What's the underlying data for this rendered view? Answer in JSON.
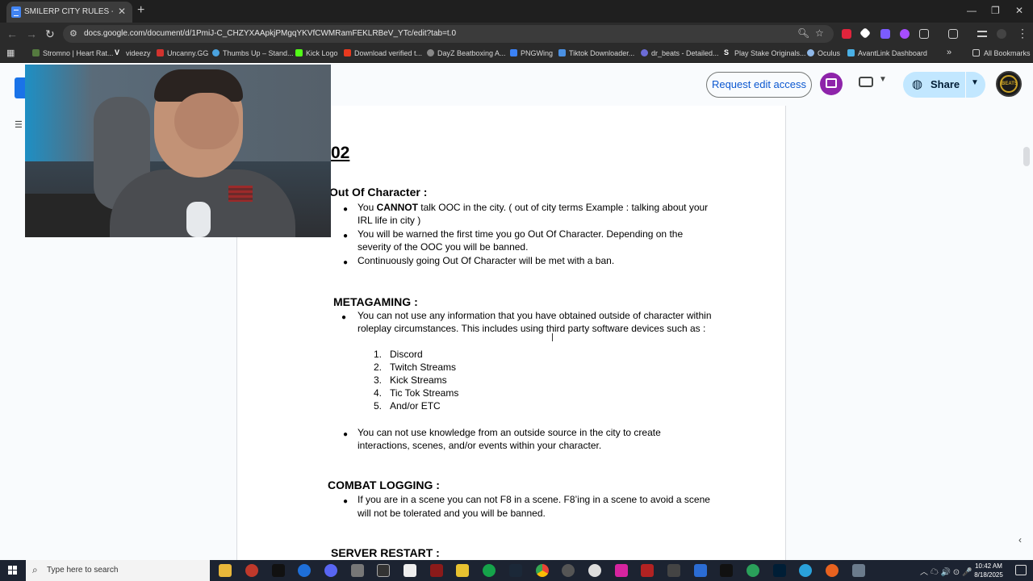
{
  "browser": {
    "tab_title": "SMILERP CITY RULES - Google",
    "new_tab": "+",
    "tab_close": "✕",
    "url": "docs.google.com/document/d/1PmiJ-C_CHZYXAApkjPMgqYKVfCWMRamFEKLRBeV_YTc/edit?tab=t.0",
    "window_controls": {
      "minimize": "—",
      "restore": "❐",
      "close": "✕"
    },
    "nav": {
      "back": "←",
      "forward": "→",
      "reload": "↻"
    },
    "bookmarks": [
      "Stromno | Heart Rat...",
      "videezy",
      "Uncanny.GG",
      "Thumbs Up – Stand...",
      "Kick Logo",
      "Download verified t...",
      "DayZ Beatboxing A...",
      "PNGWing",
      "Tiktok Downloader...",
      "dr_beats - Detailed...",
      "Play Stake Originals...",
      "Oculus",
      "AvantLink Dashboard"
    ],
    "bookmarks_more": "»",
    "all_bookmarks": "All Bookmarks"
  },
  "docs": {
    "request_edit": "Request edit access",
    "share": "Share",
    "profile_text": "BEATS"
  },
  "document": {
    "heading": "02",
    "sections": {
      "ooc": {
        "title": "Out Of Character :",
        "b1_pre": "You ",
        "b1_bold": "CANNOT",
        "b1_post": " talk OOC in the city. ( out of city terms Example : talking about your",
        "b1_line2": "IRL life in city )",
        "b2_line1": "You will be warned the first time you go Out Of Character. Depending on the",
        "b2_line2": "severity of the OOC you will be banned.",
        "b3": "Continuously going Out Of Character will be met with a ban."
      },
      "metagaming": {
        "title": "METAGAMING :",
        "b1_line1": " You can not use any information that you have obtained outside of character within",
        "b1_line2": "roleplay circumstances. This includes using third party software devices such as :",
        "list": [
          "Discord",
          "Twitch Streams",
          "Kick Streams",
          "Tic Tok Streams",
          "And/or ETC"
        ],
        "b2_line1": "You can not use knowledge from an outside source in the city to create",
        "b2_line2": "interactions, scenes, and/or events within your character."
      },
      "combat": {
        "title": "COMBAT LOGGING :",
        "b1_line1": " If you are in a scene you can not F8 in a scene. F8’ing in a scene to avoid a scene",
        "b1_line2": "will not be tolerated and you will be banned."
      },
      "restart": {
        "title": "SERVER RESTART :"
      }
    },
    "bullet": "●"
  },
  "taskbar": {
    "search_placeholder": "Type here to search",
    "time": "10:42 AM",
    "date": "8/18/2025"
  }
}
